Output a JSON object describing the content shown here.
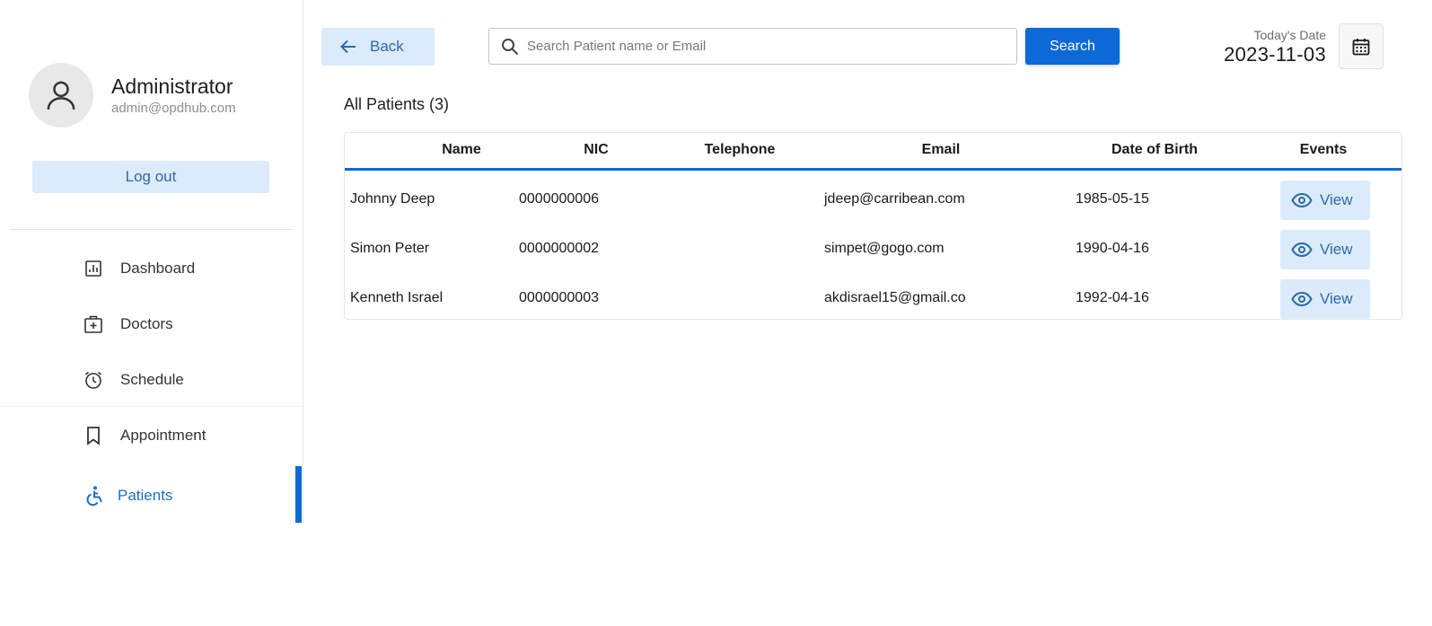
{
  "sidebar": {
    "user_name": "Administrator",
    "user_email": "admin@opdhub.com",
    "logout_label": "Log out",
    "items": [
      {
        "label": "Dashboard",
        "icon": "chart-icon"
      },
      {
        "label": "Doctors",
        "icon": "medical-bag-icon"
      },
      {
        "label": "Schedule",
        "icon": "alarm-clock-icon"
      },
      {
        "label": "Appointment",
        "icon": "bookmark-icon"
      },
      {
        "label": "Patients",
        "icon": "accessibility-icon",
        "active": true
      }
    ]
  },
  "toolbar": {
    "back_label": "Back",
    "search_placeholder": "Search Patient name or Email",
    "search_value": "",
    "search_label": "Search",
    "date_caption": "Today's Date",
    "date_value": "2023-11-03"
  },
  "main": {
    "section_title": "All Patients (3)",
    "columns": [
      "Name",
      "NIC",
      "Telephone",
      "Email",
      "Date of Birth",
      "Events"
    ],
    "rows": [
      {
        "name": "Johnny Deep",
        "nic": "0000000006",
        "telephone": "",
        "email": "jdeep@carribean.com",
        "dob": "1985-05-15",
        "action": "View"
      },
      {
        "name": "Simon Peter",
        "nic": "0000000002",
        "telephone": "",
        "email": "simpet@gogo.com",
        "dob": "1990-04-16",
        "action": "View"
      },
      {
        "name": "Kenneth Israel",
        "nic": "0000000003",
        "telephone": "",
        "email": "akdisrael15@gmail.co",
        "dob": "1992-04-16",
        "action": "View"
      }
    ]
  },
  "colors": {
    "accent": "#0c6ad6",
    "soft_button": "#dcebfa",
    "soft_button_text": "#2f69a8"
  }
}
